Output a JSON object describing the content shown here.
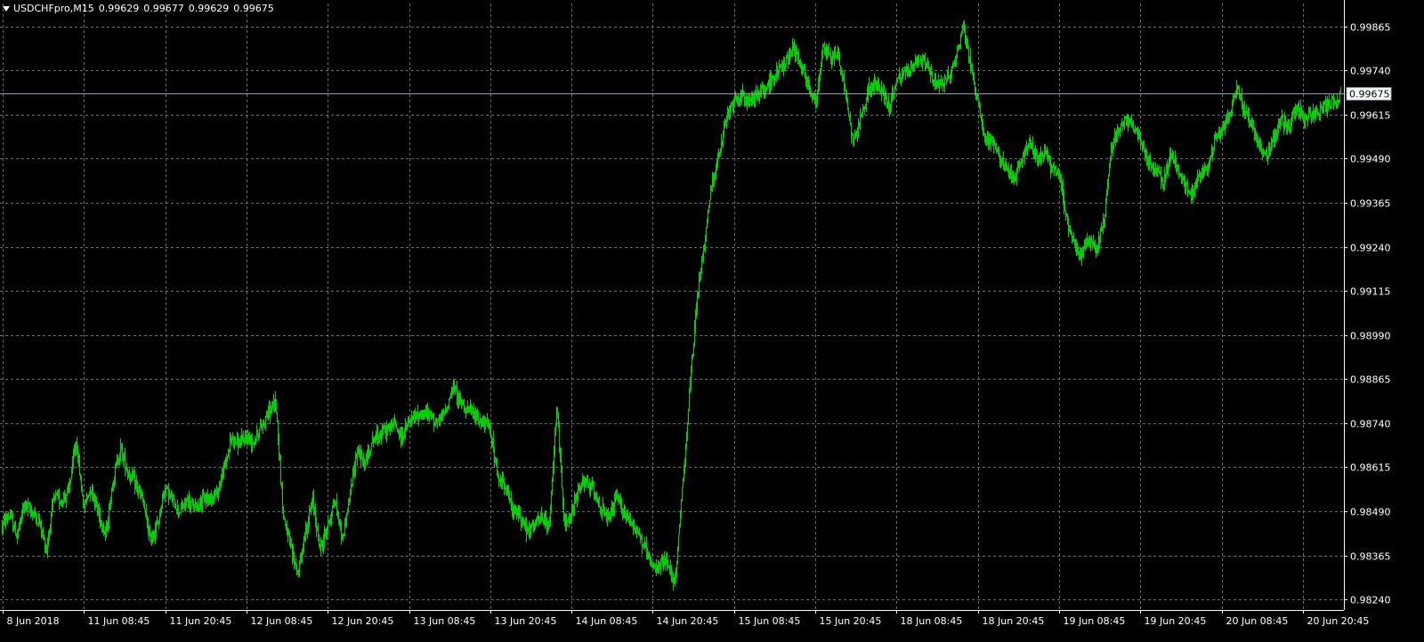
{
  "header": {
    "symbol": "USDCHFpro,M15",
    "open": "0.99629",
    "high": "0.99677",
    "low": "0.99629",
    "close": "0.99675"
  },
  "colors": {
    "background": "#000000",
    "grid": "#5f7272",
    "bars": "#00d000",
    "axis_text": "#ffffff",
    "bid_line": "#8aa0b4"
  },
  "chart_data": {
    "type": "bar",
    "title": "USDCHFpro,M15",
    "timeframe": "M15",
    "grid": true,
    "current_price": 0.99675,
    "current_price_label": "0.99675",
    "y_tick_labels": [
      "0.99865",
      "0.99740",
      "0.99615",
      "0.99490",
      "0.99365",
      "0.99240",
      "0.99115",
      "0.98990",
      "0.98865",
      "0.98740",
      "0.98615",
      "0.98490",
      "0.98365",
      "0.98240"
    ],
    "x_tick_labels": [
      "8 Jun 2018",
      "11 Jun 08:45",
      "11 Jun 20:45",
      "12 Jun 08:45",
      "12 Jun 20:45",
      "13 Jun 08:45",
      "13 Jun 20:45",
      "14 Jun 08:45",
      "14 Jun 20:45",
      "15 Jun 08:45",
      "15 Jun 20:45",
      "18 Jun 08:45",
      "18 Jun 20:45",
      "19 Jun 08:45",
      "19 Jun 20:45",
      "20 Jun 08:45",
      "20 Jun 20:45"
    ],
    "ylim": [
      0.9821,
      0.9993
    ],
    "series": [
      {
        "values": [
          0.9845,
          0.9848,
          0.9842,
          0.9851,
          0.9849,
          0.9846,
          0.9838,
          0.9853,
          0.9852,
          0.9855,
          0.9869,
          0.985,
          0.9856,
          0.9849,
          0.9842,
          0.9858,
          0.9867,
          0.986,
          0.9857,
          0.9852,
          0.9841,
          0.9845,
          0.9856,
          0.9852,
          0.9849,
          0.9852,
          0.985,
          0.9852,
          0.9853,
          0.9854,
          0.9861,
          0.987,
          0.9868,
          0.987,
          0.9869,
          0.9873,
          0.9877,
          0.988,
          0.9848,
          0.9839,
          0.9831,
          0.9843,
          0.9852,
          0.9838,
          0.9845,
          0.9852,
          0.9841,
          0.9853,
          0.9867,
          0.9862,
          0.9869,
          0.9871,
          0.9872,
          0.9874,
          0.987,
          0.9874,
          0.9876,
          0.9877,
          0.9876,
          0.9874,
          0.9878,
          0.9884,
          0.988,
          0.9878,
          0.9876,
          0.9874,
          0.9873,
          0.9858,
          0.9857,
          0.9849,
          0.9848,
          0.9843,
          0.9845,
          0.9847,
          0.9844,
          0.988,
          0.9845,
          0.9848,
          0.9856,
          0.9857,
          0.9855,
          0.985,
          0.9846,
          0.9853,
          0.9849,
          0.9846,
          0.9843,
          0.9838,
          0.9832,
          0.9834,
          0.9835,
          0.9828,
          0.9856,
          0.9884,
          0.991,
          0.9926,
          0.9943,
          0.995,
          0.9961,
          0.9965,
          0.9967,
          0.9965,
          0.9967,
          0.9969,
          0.9971,
          0.9974,
          0.9977,
          0.9981,
          0.9976,
          0.997,
          0.9964,
          0.9981,
          0.9978,
          0.9979,
          0.9968,
          0.9954,
          0.996,
          0.9968,
          0.997,
          0.9968,
          0.9964,
          0.9971,
          0.9973,
          0.9975,
          0.9977,
          0.9976,
          0.997,
          0.9971,
          0.9972,
          0.9978,
          0.9987,
          0.9974,
          0.9965,
          0.9954,
          0.9954,
          0.9948,
          0.9946,
          0.9943,
          0.995,
          0.9953,
          0.9949,
          0.9951,
          0.9946,
          0.9944,
          0.9931,
          0.9925,
          0.9922,
          0.9926,
          0.9923,
          0.9932,
          0.9952,
          0.9958,
          0.996,
          0.9958,
          0.9954,
          0.9948,
          0.9946,
          0.9942,
          0.995,
          0.9946,
          0.9941,
          0.9939,
          0.9945,
          0.9946,
          0.9954,
          0.9958,
          0.9962,
          0.997,
          0.9962,
          0.9959,
          0.9952,
          0.995,
          0.9955,
          0.996,
          0.9958,
          0.9964,
          0.996,
          0.9962,
          0.9962,
          0.9964,
          0.9965,
          0.9967
        ]
      }
    ]
  }
}
